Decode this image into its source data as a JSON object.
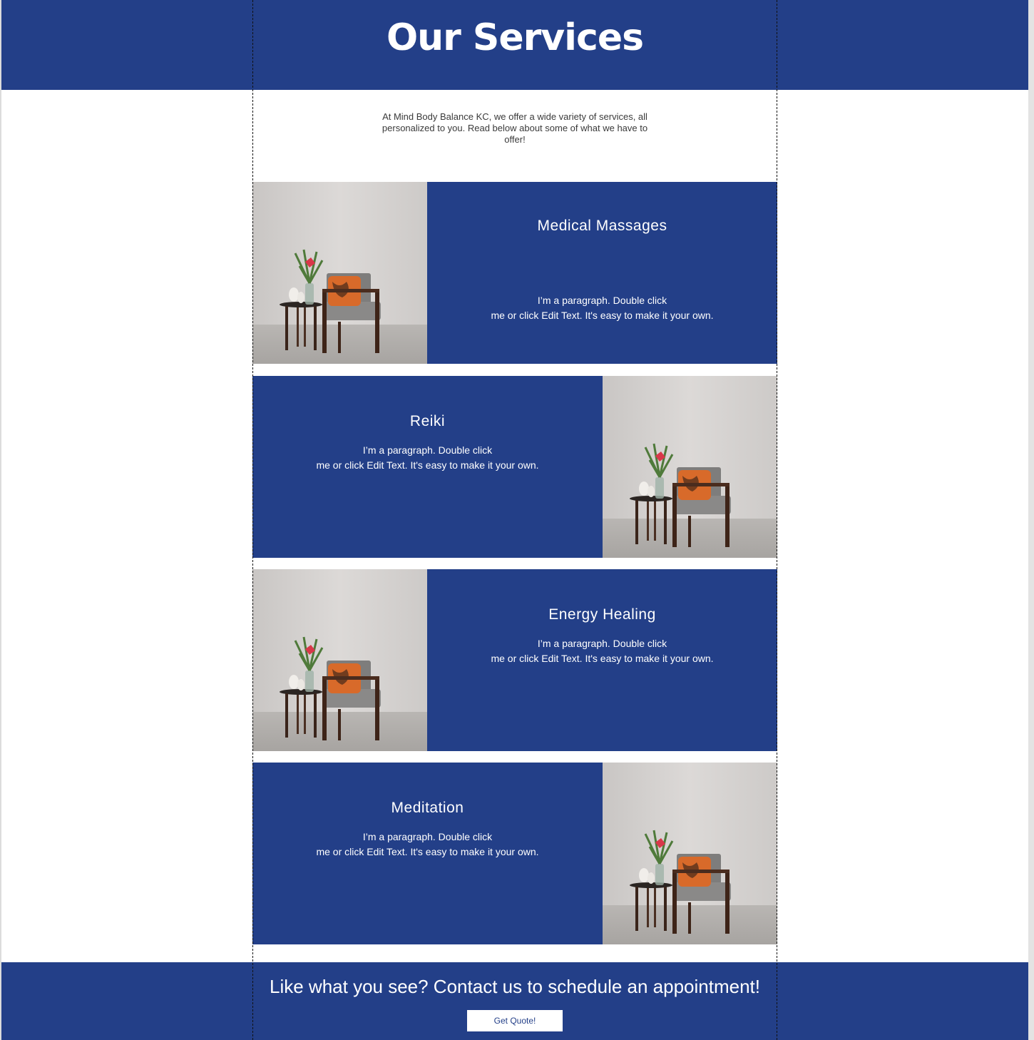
{
  "header": {
    "title": "Our Services"
  },
  "intro": {
    "text": "At Mind Body Balance KC, we offer a wide variety of services, all personalized to you. Read below about some of what we have to offer!"
  },
  "services": [
    {
      "title": "Medical Massages",
      "description": "I’m a paragraph. Double click\nme or click Edit Text. It's easy  to make it your own."
    },
    {
      "title": "Reiki",
      "description": "I’m a paragraph. Double click\nme or click Edit Text. It's easy  to make it your own."
    },
    {
      "title": "Energy Healing",
      "description": "I’m a paragraph. Double click\nme or click Edit Text. It's easy  to make it your own."
    },
    {
      "title": "Meditation",
      "description": "I’m a paragraph. Double click\nme or click Edit Text. It's easy  to make it your own."
    }
  ],
  "footer": {
    "cta_text": "Like what you see? Contact us to schedule an appointment!",
    "button_label": "Get Quote!"
  },
  "colors": {
    "brand_blue": "#233f88",
    "background": "#ffffff",
    "text_dark": "#3a3a3a"
  }
}
